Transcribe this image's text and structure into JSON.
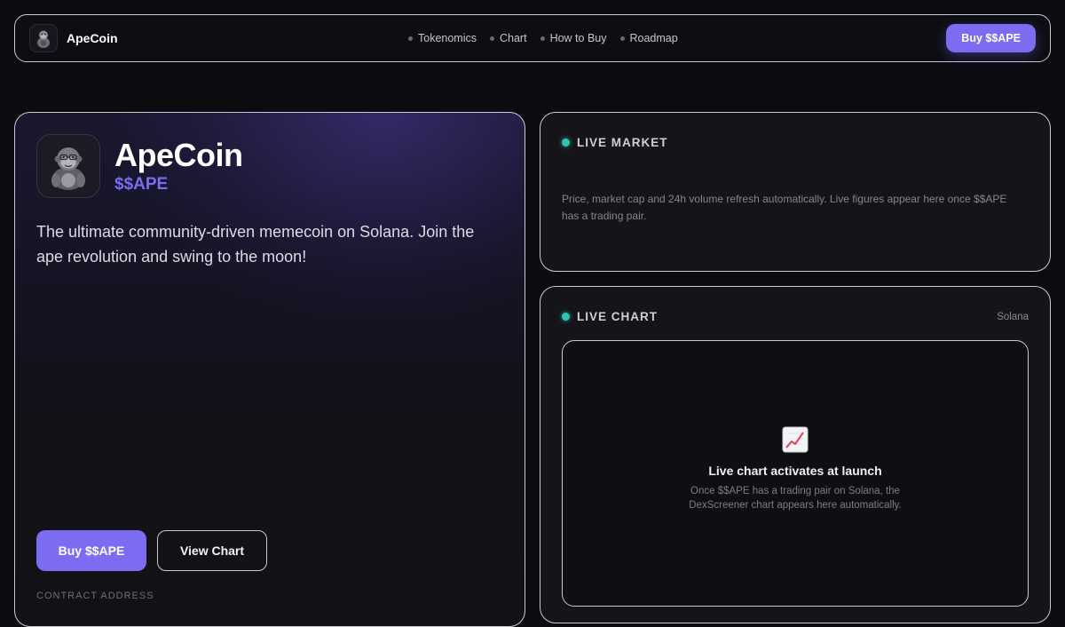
{
  "nav": {
    "brand": "ApeCoin",
    "links": [
      {
        "label": "Tokenomics"
      },
      {
        "label": "Chart"
      },
      {
        "label": "How to Buy"
      },
      {
        "label": "Roadmap"
      }
    ],
    "buy_label": "Buy $$APE"
  },
  "hero": {
    "title": "ApeCoin",
    "ticker": "$$APE",
    "description": "The ultimate community-driven memecoin on Solana. Join the ape revolution and swing to the moon!",
    "buy_label": "Buy $$APE",
    "chart_label": "View Chart",
    "contract_label": "CONTRACT ADDRESS",
    "logo_icon": "gorilla-icon"
  },
  "market": {
    "heading": "LIVE MARKET",
    "text": "Price, market cap and 24h volume refresh automatically. Live figures appear here once $$APE has a trading pair."
  },
  "chart": {
    "heading": "LIVE CHART",
    "chain": "Solana",
    "empty_icon": "chart-increasing-icon",
    "empty_title": "Live chart activates at launch",
    "empty_text": "Once $$APE has a trading pair on Solana, the DexScreener chart appears here automatically."
  },
  "colors": {
    "accent": "#7c6cf2",
    "live": "#2ec4b6",
    "background": "#0b0b10",
    "border": "#c9c9d2"
  }
}
